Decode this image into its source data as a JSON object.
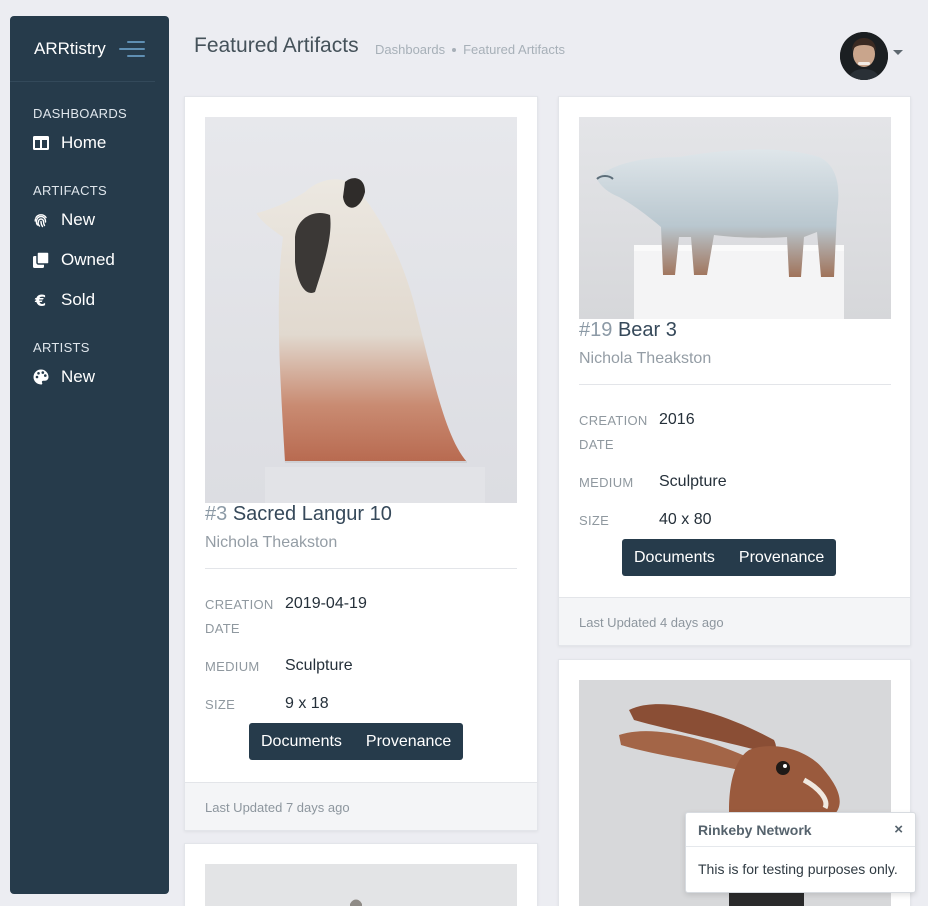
{
  "app": {
    "brand": "ARRtistry"
  },
  "sidebar": {
    "sections": [
      {
        "title": "DASHBOARDS",
        "items": [
          {
            "label": "Home",
            "icon": "columns-icon"
          }
        ]
      },
      {
        "title": "ARTIFACTS",
        "items": [
          {
            "label": "New",
            "icon": "fingerprint-icon"
          },
          {
            "label": "Owned",
            "icon": "clone-icon"
          },
          {
            "label": "Sold",
            "icon": "euro-icon"
          }
        ]
      },
      {
        "title": "ARTISTS",
        "items": [
          {
            "label": "New",
            "icon": "palette-icon"
          }
        ]
      }
    ]
  },
  "header": {
    "title": "Featured Artifacts",
    "breadcrumb": [
      "Dashboards",
      "Featured Artifacts"
    ]
  },
  "artifacts": [
    {
      "number": "#3",
      "name": "Sacred Langur 10",
      "artist": "Nichola Theakston",
      "creation_date_label_1": "CREATION",
      "creation_date_label_2": "DATE",
      "creation_date": "2019-04-19",
      "medium_label": "MEDIUM",
      "medium": "Sculpture",
      "size_label": "SIZE",
      "size": "9 x 18",
      "documents_label": "Documents",
      "provenance_label": "Provenance",
      "updated": "Last Updated 7 days ago"
    },
    {
      "number": "#19",
      "name": "Bear 3",
      "artist": "Nichola Theakston",
      "creation_date_label_1": "CREATION",
      "creation_date_label_2": "DATE",
      "creation_date": "2016",
      "medium_label": "MEDIUM",
      "medium": "Sculpture",
      "size_label": "SIZE",
      "size": "40 x 80",
      "documents_label": "Documents",
      "provenance_label": "Provenance",
      "updated": "Last Updated 4 days ago"
    }
  ],
  "toast": {
    "title": "Rinkeby Network",
    "close": "×",
    "message": "This is for testing purposes only."
  }
}
